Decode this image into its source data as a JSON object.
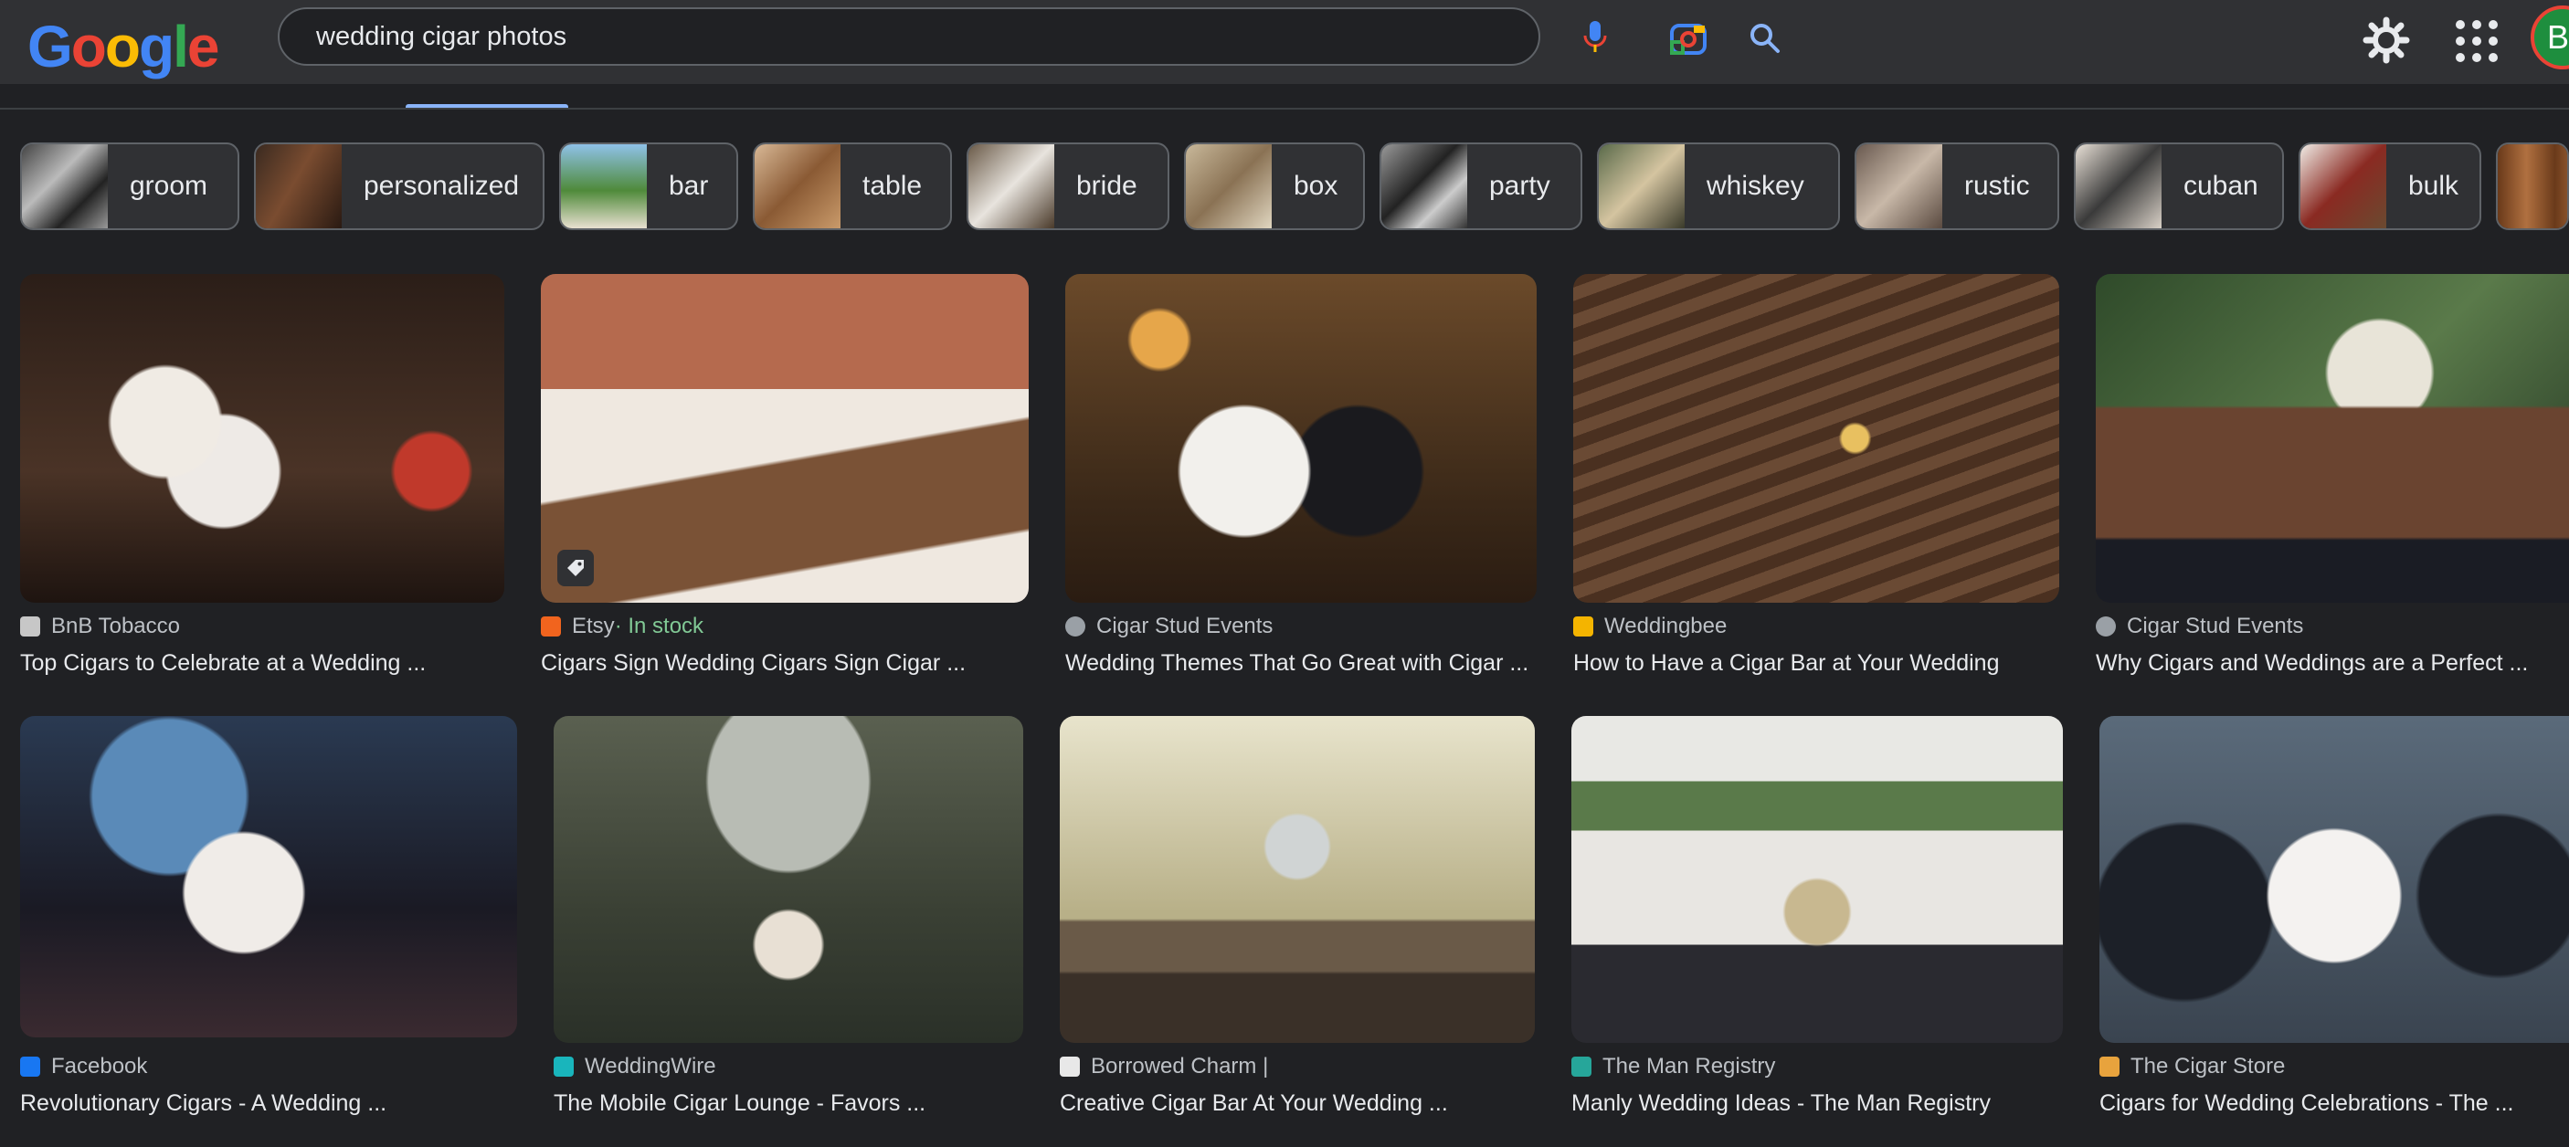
{
  "search": {
    "query": "wedding cigar photos",
    "logo_letters": [
      "G",
      "o",
      "o",
      "g",
      "l",
      "e"
    ],
    "avatar_initial": "B"
  },
  "chips": [
    {
      "label": "groom"
    },
    {
      "label": "personalized"
    },
    {
      "label": "bar"
    },
    {
      "label": "table"
    },
    {
      "label": "bride"
    },
    {
      "label": "box"
    },
    {
      "label": "party"
    },
    {
      "label": "whiskey"
    },
    {
      "label": "rustic"
    },
    {
      "label": "cuban"
    },
    {
      "label": "bulk"
    },
    {
      "label": ""
    }
  ],
  "results": [
    {
      "source": "BnB Tobacco",
      "title": "Top Cigars to Celebrate at a Wedding ...",
      "fav_color": "#c7c7c7"
    },
    {
      "source": "Etsy",
      "source_extra": " · In stock",
      "title": "Cigars Sign Wedding Cigars Sign Cigar ...",
      "fav_color": "#f1641e"
    },
    {
      "source": "Cigar Stud Events",
      "title": "Wedding Themes That Go Great with Cigar ...",
      "fav_color": "#9aa0a6"
    },
    {
      "source": "Weddingbee",
      "title": "How to Have a Cigar Bar at Your Wedding",
      "fav_color": "#f4b400"
    },
    {
      "source": "Cigar Stud Events",
      "title": "Why Cigars and Weddings are a Perfect ...",
      "fav_color": "#9aa0a6"
    },
    {
      "source": "Facebook",
      "title": "Revolutionary Cigars - A Wedding ...",
      "fav_color": "#1877f2"
    },
    {
      "source": "WeddingWire",
      "title": "The Mobile Cigar Lounge - Favors ...",
      "fav_color": "#19b5bc"
    },
    {
      "source": "Borrowed Charm |",
      "title": "Creative Cigar Bar At Your Wedding ...",
      "fav_color": "#e8e8e8"
    },
    {
      "source": "The Man Registry",
      "title": "Manly Wedding Ideas - The Man Registry",
      "fav_color": "#26a69a"
    },
    {
      "source": "The Cigar Store",
      "title": "Cigars for Wedding Celebrations - The ...",
      "fav_color": "#e8a33d"
    }
  ]
}
